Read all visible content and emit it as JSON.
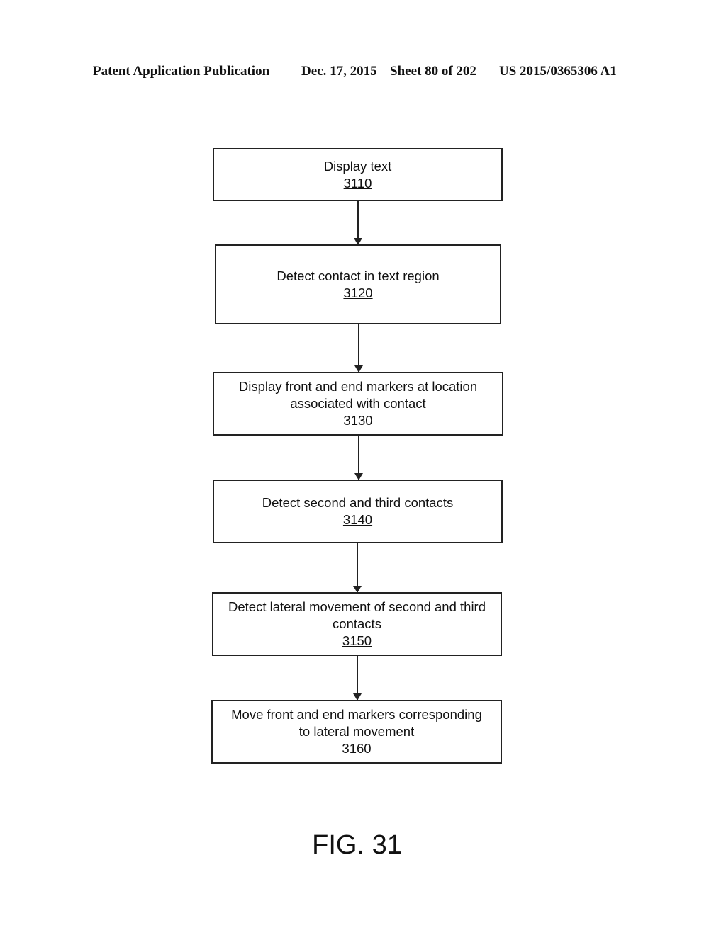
{
  "header": {
    "publication": "Patent Application Publication",
    "date": "Dec. 17, 2015",
    "sheet": "Sheet 80 of 202",
    "number": "US 2015/0365306 A1"
  },
  "steps": [
    {
      "lines": [
        "Display text"
      ],
      "ref": "3110"
    },
    {
      "lines": [
        "Detect contact in text region"
      ],
      "ref": "3120"
    },
    {
      "lines": [
        "Display front and end markers at location",
        "associated with contact"
      ],
      "ref": "3130"
    },
    {
      "lines": [
        "Detect second and third contacts"
      ],
      "ref": "3140"
    },
    {
      "lines": [
        "Detect lateral movement of second and third",
        "contacts"
      ],
      "ref": "3150"
    },
    {
      "lines": [
        "Move front and end markers corresponding",
        "to lateral movement"
      ],
      "ref": "3160"
    }
  ],
  "figure_label": "FIG. 31"
}
